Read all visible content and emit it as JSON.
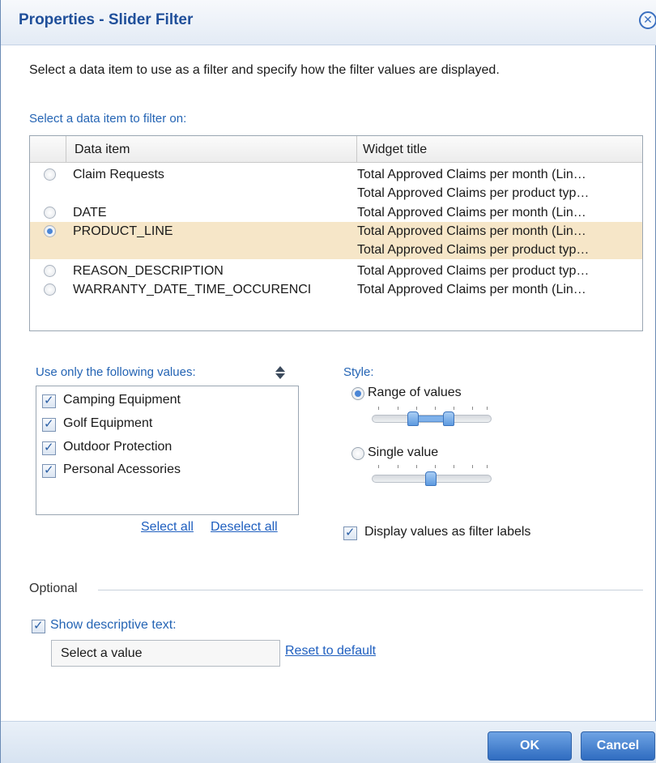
{
  "dialog": {
    "title": "Properties - Slider Filter",
    "close_icon": "close-circle-icon",
    "intro": "Select a data item to use as a filter and specify how the filter values are displayed."
  },
  "data_item_section": {
    "label": "Select a data item to filter on:",
    "columns": [
      "Data item",
      "Widget title"
    ],
    "rows": [
      {
        "data_item": "Claim Requests",
        "widget_title": "Total Approved Claims per month (Lin…",
        "selected": false
      },
      {
        "data_item": "",
        "widget_title": "Total Approved Claims per product typ…",
        "selected": false
      },
      {
        "data_item": "DATE",
        "widget_title": "Total Approved Claims per month (Lin…",
        "selected": false
      },
      {
        "data_item": "PRODUCT_LINE",
        "widget_title": "Total Approved Claims per month (Lin…",
        "selected": true
      },
      {
        "data_item": "",
        "widget_title": "Total Approved Claims per product typ…",
        "selected": true
      },
      {
        "data_item": "REASON_DESCRIPTION",
        "widget_title": "Total Approved Claims per product typ…",
        "selected": false
      },
      {
        "data_item": "WARRANTY_DATE_TIME_OCCURENCI",
        "widget_title": "Total Approved Claims per month (Lin…",
        "selected": false
      }
    ]
  },
  "values_section": {
    "label": "Use only the following values:",
    "sort_icon": "sort-up-down-icon",
    "items": [
      {
        "label": "Camping Equipment",
        "checked": true
      },
      {
        "label": "Golf Equipment",
        "checked": true
      },
      {
        "label": "Outdoor Protection",
        "checked": true
      },
      {
        "label": "Personal Acessories",
        "checked": true
      }
    ],
    "select_all": "Select all",
    "deselect_all": "Deselect all"
  },
  "style_section": {
    "label": "Style:",
    "range_label": "Range of values",
    "single_label": "Single value",
    "selected": "range",
    "display_labels": "Display values as filter labels",
    "display_labels_checked": true
  },
  "optional_section": {
    "label": "Optional",
    "show_text_label": "Show descriptive text:",
    "show_text_checked": true,
    "text_value": "Select a value",
    "reset_link": "Reset to default"
  },
  "footer": {
    "ok": "OK",
    "cancel": "Cancel"
  },
  "colors": {
    "title": "#1f4f9a",
    "link": "#1f5fbf",
    "selected_row": "#f6e6c8",
    "button": "#2f6cc0"
  }
}
